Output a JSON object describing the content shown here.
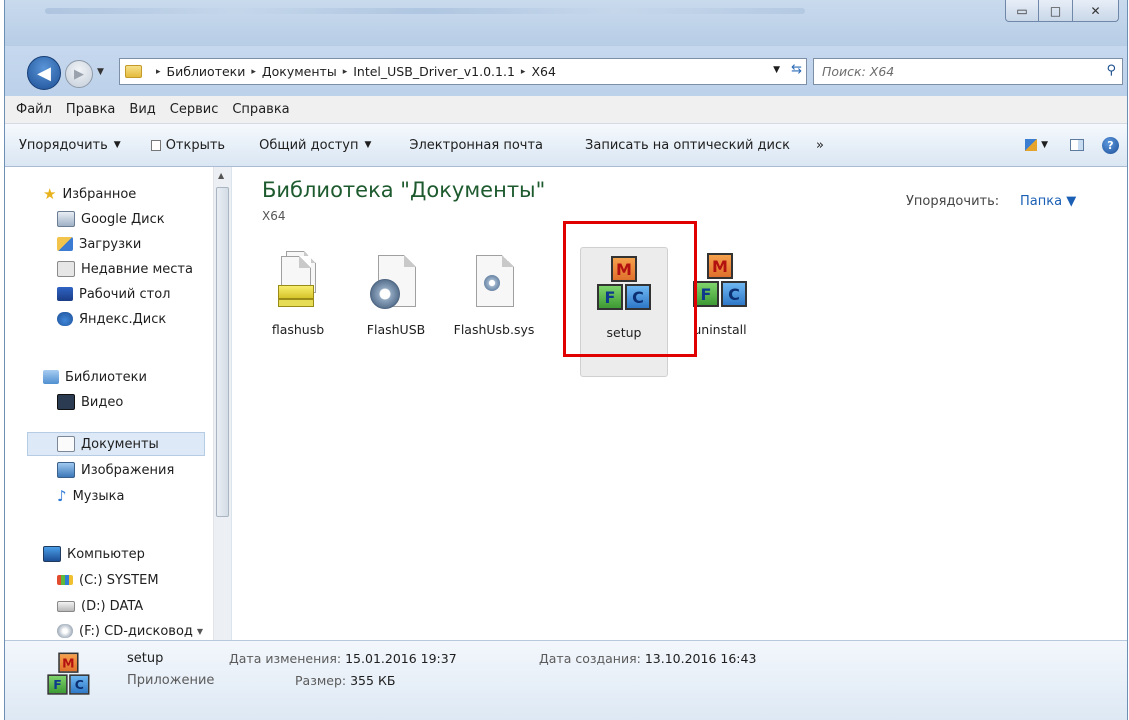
{
  "window": {
    "minimize": "▭",
    "maximize": "□",
    "close": "✕"
  },
  "address": {
    "crumbs": [
      "Библиотеки",
      "Документы",
      "Intel_USB_Driver_v1.0.1.1",
      "X64"
    ],
    "separator": "▸"
  },
  "search": {
    "placeholder": "Поиск: X64"
  },
  "menu": [
    "Файл",
    "Правка",
    "Вид",
    "Сервис",
    "Справка"
  ],
  "toolbar": {
    "organize": "Упорядочить",
    "open": "Открыть",
    "share": "Общий доступ",
    "email": "Электронная почта",
    "burn": "Записать на оптический диск",
    "more": "»"
  },
  "nav": {
    "favorites": "Избранное",
    "google_drive": "Google Диск",
    "downloads": "Загрузки",
    "recent": "Недавние места",
    "desktop": "Рабочий стол",
    "yandex": "Яндекс.Диск",
    "libraries": "Библиотеки",
    "video": "Видео",
    "documents": "Документы",
    "images": "Изображения",
    "music": "Музыка",
    "computer": "Компьютер",
    "drive_c": "(C:) SYSTEM",
    "drive_d": "(D:) DATA",
    "drive_f": "(F:) CD-дисковод"
  },
  "content": {
    "title": "Библиотека \"Документы\"",
    "subtitle": "X64",
    "arrange_label": "Упорядочить:",
    "arrange_value": "Папка ▼",
    "files": [
      {
        "name": "flashusb"
      },
      {
        "name": "FlashUSB"
      },
      {
        "name": "FlashUsb.sys"
      },
      {
        "name": "setup"
      },
      {
        "name": "uninstall"
      }
    ]
  },
  "details": {
    "name": "setup",
    "type": "Приложение",
    "modified_label": "Дата изменения:",
    "modified_value": "15.01.2016 19:37",
    "size_label": "Размер:",
    "size_value": "355 КБ",
    "created_label": "Дата создания:",
    "created_value": "13.10.2016 16:43"
  }
}
